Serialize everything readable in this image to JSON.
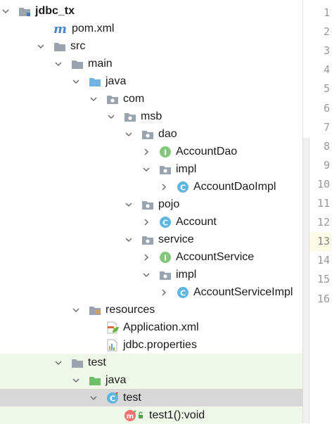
{
  "colors": {
    "green_row_bg": "#eff7e8",
    "selected_row_bg": "#d7d7d7",
    "current_line_bg": "#fdfbe5",
    "interface_icon": "#83c77b",
    "class_icon": "#5fb6e1",
    "folder_icon": "#9aa4ae"
  },
  "project_tree": [
    {
      "label": "jdbc_tx",
      "icon": "module-folder-icon",
      "expanded": true,
      "bold": true
    },
    {
      "label": "pom.xml",
      "icon": "maven-icon",
      "expanded": null
    },
    {
      "label": "src",
      "icon": "folder-icon",
      "expanded": true
    },
    {
      "label": "main",
      "icon": "folder-icon",
      "expanded": true
    },
    {
      "label": "java",
      "icon": "source-root-icon",
      "expanded": true
    },
    {
      "label": "com",
      "icon": "package-icon",
      "expanded": true
    },
    {
      "label": "msb",
      "icon": "package-icon",
      "expanded": true
    },
    {
      "label": "dao",
      "icon": "package-icon",
      "expanded": true
    },
    {
      "label": "AccountDao",
      "icon": "interface-icon",
      "expanded": false
    },
    {
      "label": "impl",
      "icon": "package-icon",
      "expanded": true
    },
    {
      "label": "AccountDaoImpl",
      "icon": "class-icon",
      "expanded": false
    },
    {
      "label": "pojo",
      "icon": "package-icon",
      "expanded": true
    },
    {
      "label": "Account",
      "icon": "class-icon",
      "expanded": false
    },
    {
      "label": "service",
      "icon": "package-icon",
      "expanded": true
    },
    {
      "label": "AccountService",
      "icon": "interface-icon",
      "expanded": false
    },
    {
      "label": "impl",
      "icon": "package-icon",
      "expanded": true
    },
    {
      "label": "AccountServiceImpl",
      "icon": "class-icon",
      "expanded": false
    },
    {
      "label": "resources",
      "icon": "resources-folder-icon",
      "expanded": true
    },
    {
      "label": "Application.xml",
      "icon": "spring-xml-icon",
      "expanded": null
    },
    {
      "label": "jdbc.properties",
      "icon": "properties-icon",
      "expanded": null
    },
    {
      "label": "test",
      "icon": "folder-icon",
      "expanded": true
    },
    {
      "label": "java",
      "icon": "test-source-root-icon",
      "expanded": true
    },
    {
      "label": "test",
      "icon": "test-class-icon",
      "expanded": true
    },
    {
      "label": "test1():void",
      "icon": "method-icon",
      "expanded": null
    }
  ],
  "line_numbers": [
    "1",
    "2",
    "3",
    "4",
    "5",
    "6",
    "7",
    "8",
    "9",
    "10",
    "11",
    "12",
    "13",
    "14",
    "15",
    "16"
  ],
  "current_line": "13"
}
